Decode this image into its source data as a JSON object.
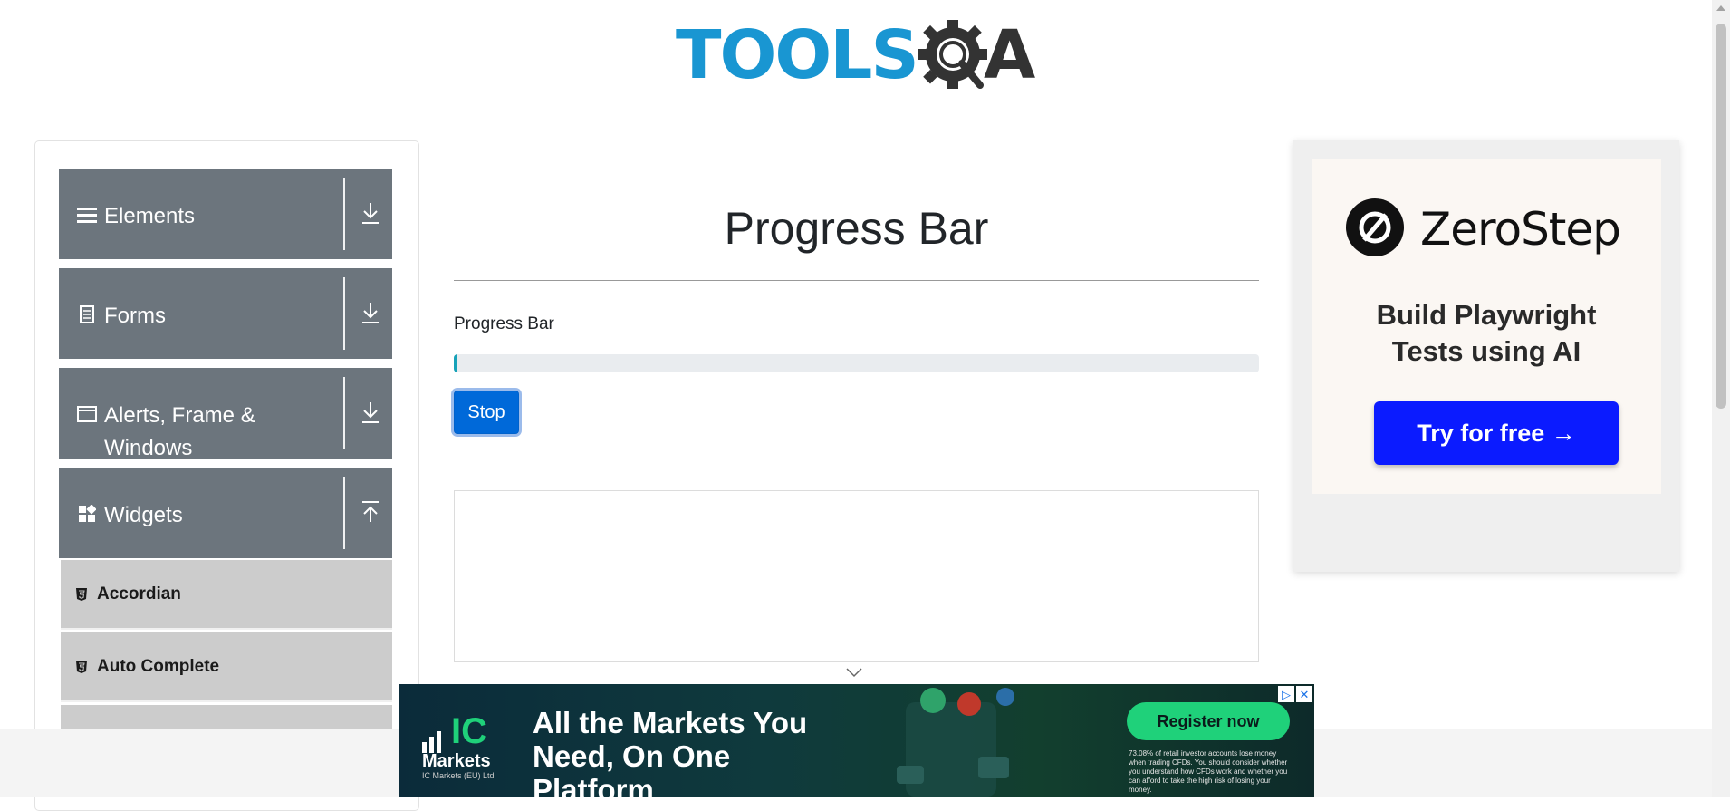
{
  "header": {
    "logo_text": "TOOLS",
    "logo_suffix": "A"
  },
  "sidebar": {
    "groups": [
      {
        "label": "Elements",
        "icon": "hamburger-icon",
        "expanded": false
      },
      {
        "label": "Forms",
        "icon": "document-icon",
        "expanded": false
      },
      {
        "label": "Alerts, Frame & Windows",
        "icon": "window-icon",
        "expanded": false
      },
      {
        "label": "Widgets",
        "icon": "widgets-icon",
        "expanded": true
      }
    ],
    "widget_items": [
      {
        "label": "Accordian",
        "icon": "html5-icon"
      },
      {
        "label": "Auto Complete",
        "icon": "html5-icon"
      }
    ]
  },
  "main": {
    "title": "Progress Bar",
    "progress_label": "Progress Bar",
    "progress_value": 0.004,
    "stop_label": "Stop"
  },
  "right_ad": {
    "brand": "ZeroStep",
    "tagline_line1": "Build Playwright",
    "tagline_line2": "Tests using AI",
    "cta": "Try for free →"
  },
  "bottom_ad": {
    "brand_short": "IC",
    "brand_name": "Markets",
    "brand_entity": "IC Markets (EU) Ltd",
    "headline_line1": "All the Markets You",
    "headline_line2": "Need, On One Platform",
    "cta": "Register now",
    "disclaimer": "73.08% of retail investor accounts lose money when trading CFDs. You should consider whether you understand how CFDs work and whether you can afford to take the high risk of losing your money."
  },
  "colors": {
    "sidebar_header": "#6c757d",
    "sidebar_item": "#cccccc",
    "primary_button": "#0069d9",
    "progress_track": "#e9ecef",
    "progress_fill": "#17a2b8",
    "zerostep_cta": "#0b1bff",
    "icmarkets_green": "#1fd17a"
  }
}
